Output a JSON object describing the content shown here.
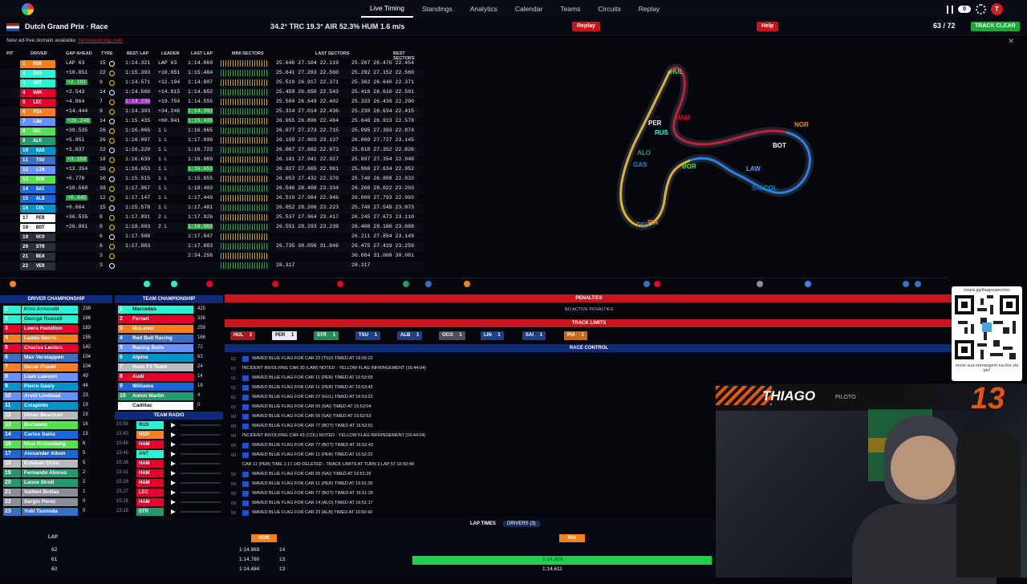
{
  "nav": {
    "items": [
      "Live Timing",
      "Standings",
      "Analytics",
      "Calendar",
      "Teams",
      "Circuits",
      "Replay"
    ],
    "active": "Live Timing",
    "counter": "0",
    "avatar": "T"
  },
  "header": {
    "title": "Dutch Grand Prix · Race",
    "weather": "34.2° TRC   19.3° AIR   52.3% HUM   1.6 m/s",
    "replay": "Replay",
    "help": "Help",
    "laps": "63 / 72",
    "status": "TRACK CLEAR"
  },
  "notice": {
    "text": "New ad-free domain available:",
    "link": "formula-timing.com"
  },
  "columns": [
    "PIT",
    "DRIVER",
    "GAP AHEAD",
    "TYRE",
    "BEST LAP",
    "LEADER",
    "LAST LAP",
    "MINI SECTORS",
    "LAST SECTORS",
    "BEST SECTORS"
  ],
  "timing": [
    {
      "p": "1",
      "d": "NOR",
      "c": "#f58020",
      "gap": "LAP 63",
      "ty": "15",
      "best": "1:14.321",
      "lead": "LAP 63",
      "last": "1:14.869",
      "ls": "25.646 27.104 22.119",
      "bs": "25.267 26.476 22.454"
    },
    {
      "p": "2",
      "d": "RUS",
      "c": "#27f4d2",
      "gap": "+10.851",
      "ty": "22",
      "best": "1:15.393",
      "lead": "+10.851",
      "last": "1:15.484",
      "ls": "25.641 27.283 22.560",
      "bs": "25.292 27.152 22.560"
    },
    {
      "p": "3",
      "d": "ANT",
      "c": "#27f4d2",
      "gap": "+2.101",
      "ty": "9",
      "best": "1:14.571",
      "lead": "+12.194",
      "last": "1:14.807",
      "ls": "25.519 26.917 22.371",
      "bs": "25.362 26.640 22.371"
    },
    {
      "p": "4",
      "d": "HAM",
      "c": "#e8002d",
      "gap": "+2.543",
      "ty": "14",
      "best": "1:14.566",
      "lead": "+14.815",
      "last": "1:14.652",
      "ls": "25.459 26.650 22.543",
      "bs": "25.410 26.610 22.501"
    },
    {
      "p": "5",
      "d": "LEC",
      "c": "#e8002d",
      "gap": "+4.864",
      "ty": "7",
      "best": "1:14.230",
      "lead": "+19.754",
      "last": "1:14.555",
      "ls": "25.504 26.649 22.402",
      "bs": "25.333 26.439 22.290"
    },
    {
      "p": "6",
      "d": "PIA",
      "c": "#f58020",
      "gap": "+14.444",
      "ty": "9",
      "best": "1:14.303",
      "lead": "+34.246",
      "last": "1:14.303",
      "ls": "25.314 27.014 22.436",
      "bs": "25.230 26.634 22.415"
    },
    {
      "p": "7",
      "d": "LAW",
      "c": "#6692ff",
      "gap": "+26.248",
      "ty": "14",
      "best": "1:15.435",
      "lead": "+60.841",
      "last": "1:15.435",
      "ls": "26.055 26.896 22.484",
      "bs": "25.648 26.913 22.578"
    },
    {
      "p": "8",
      "d": "HUL",
      "c": "#52e252",
      "gap": "+39.535",
      "ty": "26",
      "best": "1:16.065",
      "lead": "1 L",
      "last": "1:16.065",
      "ls": "26.077 27.273 22.715",
      "bs": "25.995 27.393 22.874"
    },
    {
      "p": "9",
      "d": "ALO",
      "c": "#229971",
      "gap": "+5.851",
      "ty": "26",
      "best": "1:16.097",
      "lead": "1 L",
      "last": "1:17.099",
      "ls": "26.159 27.803 23.137",
      "bs": "26.069 27.727 23.145"
    },
    {
      "p": "10",
      "d": "GAS",
      "c": "#0093cc",
      "gap": "+1.637",
      "ty": "22",
      "best": "1:16.220",
      "lead": "1 L",
      "last": "1:16.722",
      "ls": "26.067 27.682 22.973",
      "bs": "25.818 27.352 22.826"
    },
    {
      "p": "11",
      "d": "TSU",
      "c": "#3671c6",
      "gap": "+3.159",
      "ty": "18",
      "best": "1:16.639",
      "lead": "1 L",
      "last": "1:16.969",
      "ls": "26.101 27.941 22.927",
      "bs": "25.897 27.354 22.948"
    },
    {
      "p": "12",
      "d": "LIN",
      "c": "#6692ff",
      "gap": "+13.354",
      "ty": "16",
      "best": "1:16.653",
      "lead": "1 L",
      "last": "1:16.653",
      "ls": "26.027 27.665 22.961",
      "bs": "25.968 27.634 22.952"
    },
    {
      "p": "13",
      "d": "BOR",
      "c": "#52e252",
      "gap": "+0.778",
      "ty": "10",
      "best": "1:15.515",
      "lead": "1 L",
      "last": "1:15.855",
      "ls": "26.053 27.432 22.370",
      "bs": "25.740 26.808 22.833"
    },
    {
      "p": "14",
      "d": "SAI",
      "c": "#1868db",
      "gap": "+18.568",
      "ty": "38",
      "best": "1:17.967",
      "lead": "1 L",
      "last": "1:18.403",
      "ls": "26.546 28.408 23.334",
      "bs": "26.268 28.022 23.203"
    },
    {
      "p": "15",
      "d": "ALB",
      "c": "#1868db",
      "gap": "+0.445",
      "ty": "12",
      "best": "1:17.147",
      "lead": "1 L",
      "last": "1:17.449",
      "ls": "26.519 27.984 22.946",
      "bs": "26.000 27.793 22.993"
    },
    {
      "p": "16",
      "d": "COL",
      "c": "#0093cc",
      "gap": "+0.664",
      "ty": "15",
      "best": "1:15.578",
      "lead": "1 L",
      "last": "1:17.481",
      "ls": "26.052 28.206 23.223",
      "bs": "25.740 27.549 23.073"
    },
    {
      "p": "17",
      "d": "PER",
      "c": "#ffffff",
      "gap": "+36.535",
      "ty": "8",
      "best": "1:17.891",
      "lead": "2 L",
      "last": "1:17.926",
      "ls": "25.537 27.964 23.417",
      "bs": "26.245 27.673 23.110"
    },
    {
      "p": "18",
      "d": "BOT",
      "c": "#ffffff",
      "gap": "+26.801",
      "ty": "8",
      "best": "1:18.083",
      "lead": "2 L",
      "last": "1:18.083",
      "ls": "26.551 28.293 23.239",
      "bs": "26.408 28.180 23.088"
    },
    {
      "p": "19",
      "d": "OCO",
      "c": "#b6babd",
      "gap": "",
      "ty": "6",
      "best": "1:17.588",
      "lead": "",
      "last": "1:17.847",
      "ls": "",
      "bs": "26.211 27.854 23.149"
    },
    {
      "p": "20",
      "d": "STR",
      "c": "#229971",
      "gap": "",
      "ty": "6",
      "best": "1:17.883",
      "lead": "",
      "last": "1:17.883",
      "ls": "26.735 38.056 31.946",
      "bs": "26.475 27.419 23.259"
    },
    {
      "p": "21",
      "d": "BEA",
      "c": "#b6babd",
      "gap": "",
      "ty": "3",
      "best": "",
      "lead": "",
      "last": "2:34.256",
      "ls": "",
      "bs": "36.084 31.008 30.081"
    },
    {
      "p": "22",
      "d": "VER",
      "c": "#3671c6",
      "gap": "",
      "ty": "3",
      "best": "",
      "lead": "",
      "last": "",
      "ls": "28.317",
      "bs": "28.317"
    }
  ],
  "track_labels": [
    {
      "t": "NOR",
      "c": "#f58020"
    },
    {
      "t": "BOT",
      "c": "#ffffff"
    },
    {
      "t": "PER",
      "c": "#ffffff"
    },
    {
      "t": "HAM",
      "c": "#e8002d"
    },
    {
      "t": "HUL",
      "c": "#52e252"
    },
    {
      "t": "RUS",
      "c": "#27f4d2"
    },
    {
      "t": "ALO",
      "c": "#229971"
    },
    {
      "t": "GAS",
      "c": "#0093cc"
    },
    {
      "t": "BOR",
      "c": "#52e252"
    },
    {
      "t": "LAW",
      "c": "#6692ff"
    },
    {
      "t": "SAI",
      "c": "#1868db"
    },
    {
      "t": "COL",
      "c": "#0093cc"
    },
    {
      "t": "PIA",
      "c": "#f58020"
    },
    {
      "t": "TSU",
      "c": "#3671c6"
    }
  ],
  "driver_championship": {
    "title": "DRIVER CHAMPIONSHIP",
    "rows": [
      {
        "p": "1",
        "n": "Kimi Antonelli",
        "c": "#27f4d2",
        "pts": "239"
      },
      {
        "p": "2",
        "n": "George Russell",
        "c": "#27f4d2",
        "pts": "186"
      },
      {
        "p": "3",
        "n": "Lewis Hamilton",
        "c": "#e8002d",
        "pts": "183"
      },
      {
        "p": "4",
        "n": "Lando Norris",
        "c": "#f58020",
        "pts": "155"
      },
      {
        "p": "5",
        "n": "Charles Leclerc",
        "c": "#e8002d",
        "pts": "142"
      },
      {
        "p": "6",
        "n": "Max Verstappen",
        "c": "#3671c6",
        "pts": "104"
      },
      {
        "p": "7",
        "n": "Oscar Piastri",
        "c": "#f58020",
        "pts": "104"
      },
      {
        "p": "8",
        "n": "Liam Lawson",
        "c": "#6692ff",
        "pts": "49"
      },
      {
        "p": "9",
        "n": "Pierre Gasly",
        "c": "#0093cc",
        "pts": "44"
      },
      {
        "p": "10",
        "n": "Arvid Lindblad",
        "c": "#6692ff",
        "pts": "23"
      },
      {
        "p": "11",
        "n": "Colapinto",
        "c": "#0093cc",
        "pts": "19"
      },
      {
        "p": "12",
        "n": "Oliver Bearman",
        "c": "#b6babd",
        "pts": "19"
      },
      {
        "p": "13",
        "n": "Bortoleto",
        "c": "#52e252",
        "pts": "16"
      },
      {
        "p": "14",
        "n": "Carlos Sainz",
        "c": "#1868db",
        "pts": "13"
      },
      {
        "p": "16",
        "n": "Nico Hulkenberg",
        "c": "#52e252",
        "pts": "6"
      },
      {
        "p": "17",
        "n": "Alexander Albon",
        "c": "#1868db",
        "pts": "5"
      },
      {
        "p": "18",
        "n": "Esteban Ocon",
        "c": "#b6babd",
        "pts": "5"
      },
      {
        "p": "19",
        "n": "Fernando Alonso",
        "c": "#229971",
        "pts": "2"
      },
      {
        "p": "20",
        "n": "Lance Stroll",
        "c": "#229971",
        "pts": "2"
      },
      {
        "p": "21",
        "n": "Valtteri Bottas",
        "c": "#8a8f99",
        "pts": "1"
      },
      {
        "p": "22",
        "n": "Sergio Perez",
        "c": "#8a8f99",
        "pts": "0"
      },
      {
        "p": "23",
        "n": "Yuki Tsunoda",
        "c": "#3671c6",
        "pts": "0"
      }
    ]
  },
  "team_championship": {
    "title": "TEAM CHAMPIONSHIP",
    "rows": [
      {
        "p": "1",
        "n": "Mercedes",
        "c": "#27f4d2",
        "pts": "425"
      },
      {
        "p": "2",
        "n": "Ferrari",
        "c": "#e8002d",
        "pts": "338"
      },
      {
        "p": "3",
        "n": "McLaren",
        "c": "#f58020",
        "pts": "259"
      },
      {
        "p": "4",
        "n": "Red Bull Racing",
        "c": "#3671c6",
        "pts": "166"
      },
      {
        "p": "5",
        "n": "Racing Bulls",
        "c": "#6692ff",
        "pts": "72"
      },
      {
        "p": "6",
        "n": "Alpine",
        "c": "#0093cc",
        "pts": "63"
      },
      {
        "p": "7",
        "n": "Haas F1 Team",
        "c": "#b6babd",
        "pts": "24"
      },
      {
        "p": "8",
        "n": "Audi",
        "c": "#e8002d",
        "pts": "14"
      },
      {
        "p": "9",
        "n": "Williams",
        "c": "#1868db",
        "pts": "18"
      },
      {
        "p": "10",
        "n": "Aston Martin",
        "c": "#229971",
        "pts": "4"
      },
      {
        "p": "11",
        "n": "Cadillac",
        "c": "#ffffff",
        "pts": "0"
      }
    ]
  },
  "team_radio": {
    "title": "TEAM RADIO",
    "rows": [
      {
        "t": "15:58",
        "d": "RUS",
        "c": "#27f4d2"
      },
      {
        "t": "15:40",
        "d": "NOR",
        "c": "#f58020"
      },
      {
        "t": "15:48",
        "d": "HAM",
        "c": "#e8002d"
      },
      {
        "t": "15:46",
        "d": "ANT",
        "c": "#27f4d2"
      },
      {
        "t": "15:38",
        "d": "HAM",
        "c": "#e8002d"
      },
      {
        "t": "15:31",
        "d": "HAM",
        "c": "#e8002d"
      },
      {
        "t": "15:28",
        "d": "HAM",
        "c": "#e8002d"
      },
      {
        "t": "15:27",
        "d": "LEC",
        "c": "#e8002d"
      },
      {
        "t": "15:18",
        "d": "HAM",
        "c": "#e8002d"
      },
      {
        "t": "15:18",
        "d": "STR",
        "c": "#229971"
      }
    ]
  },
  "penalties": {
    "title": "PENALTIES",
    "empty": "NO ACTIVE PENALTIES"
  },
  "track_limits": {
    "title": "TRACK LIMITS",
    "chips": [
      {
        "d": "HUL",
        "n": "2",
        "c": "#b0141c"
      },
      {
        "d": "PER",
        "n": "1",
        "c": "#e9ecf2"
      },
      {
        "d": "STR",
        "n": "1",
        "c": "#1f8f55"
      },
      {
        "d": "TSU",
        "n": "1",
        "c": "#1e3f8a"
      },
      {
        "d": "ALB",
        "n": "1",
        "c": "#1e3f8a"
      },
      {
        "d": "OCO",
        "n": "1",
        "c": "#4a4f58"
      },
      {
        "d": "LIN",
        "n": "1",
        "c": "#1e3f8a"
      },
      {
        "d": "SAI",
        "n": "1",
        "c": "#1e3f8a"
      },
      {
        "d": "PIA",
        "n": "1",
        "c": "#c96a10"
      }
    ]
  },
  "race_control": {
    "title": "RACE CONTROL",
    "rows": [
      {
        "n": "62",
        "t": "WAVED BLUE FLAG FOR CAR 22 (TSU) TIMED AT 16:55:22",
        "f": true
      },
      {
        "n": "61",
        "t": "INCIDENT INVOLVING CAR 30 (LAW) NOTED - YELLOW FLAG INFRINGEMENT (16:44:04)",
        "f": false
      },
      {
        "n": "61",
        "t": "WAVED BLUE FLAG FOR CAR 11 (PER) TIMED AT 16:53:58",
        "f": true
      },
      {
        "n": "61",
        "t": "WAVED BLUE FLAG FOR CAR 11 (PER) TIMED AT 16:53:43",
        "f": true
      },
      {
        "n": "61",
        "t": "WAVED BLUE FLAG FOR CAR 27 (HUL) TIMED AT 16:53:22",
        "f": true
      },
      {
        "n": "61",
        "t": "WAVED BLUE FLAG FOR CAR 55 (SAI) TIMED AT 16:53:04",
        "f": true
      },
      {
        "n": "60",
        "t": "WAVED BLUE FLAG FOR CAR 55 (SAI) TIMED AT 16:52:53",
        "f": true
      },
      {
        "n": "60",
        "t": "WAVED BLUE FLAG FOR CAR 77 (BOT) TIMED AT 16:52:51",
        "f": true
      },
      {
        "n": "60",
        "t": "INCIDENT INVOLVING CAR 43 (COL) NOTED - YELLOW FLAG INFRINGEMENT (16:44:04)",
        "f": false
      },
      {
        "n": "60",
        "t": "WAVED BLUE FLAG FOR CAR 77 (BOT) TIMED AT 16:52:43",
        "f": true
      },
      {
        "n": "60",
        "t": "WAVED BLUE FLAG FOR CAR 11 (PER) TIMED AT 16:52:22",
        "f": true
      },
      {
        "n": "",
        "t": "CAR 11 (PER) TIME 1:17.149 DELETED - TRACK LIMITS AT TURN 3 LAP 57 16:50:48",
        "f": false
      },
      {
        "n": "59",
        "t": "WAVED BLUE FLAG FOR CAR 55 (SAI) TIMED AT 16:51:35",
        "f": true
      },
      {
        "n": "59",
        "t": "WAVED BLUE FLAG FOR CAR 11 (PER) TIMED AT 16:51:30",
        "f": true
      },
      {
        "n": "59",
        "t": "WAVED BLUE FLAG FOR CAR 77 (BOT) TIMED AT 16:51:28",
        "f": true
      },
      {
        "n": "59",
        "t": "WAVED BLUE FLAG FOR CAR 14 (ALO) TIMED AT 16:51:17",
        "f": true
      },
      {
        "n": "59",
        "t": "WAVED BLUE FLAG FOR CAR 23 (ALB) TIMED AT 16:50:43",
        "f": true
      },
      {
        "n": "58",
        "t": "WAVED BLUE FLAG FOR CAR 23 (ALB) TIMED AT 16:50:36",
        "f": true
      }
    ]
  },
  "lap_times": {
    "title": "LAP TIMES",
    "filter": "DRIVERS (3)",
    "lap_header": "LAP",
    "d1": "NOR",
    "d2": "PIA",
    "rows": [
      {
        "lap": "62",
        "a": "1:14.869",
        "an": "14",
        "b": ""
      },
      {
        "lap": "61",
        "a": "1:14.760",
        "an": "13",
        "b": "1:14.303"
      },
      {
        "lap": "60",
        "a": "1:14.484",
        "an": "13",
        "b": "1:14.611"
      }
    ]
  },
  "qr": {
    "top": "livepix.gg/thiagosannches",
    "bottom": "envie sua mensagem na live via pix!"
  },
  "overlay": {
    "name": "THIAGO",
    "role": "PILOTO",
    "number": "13"
  }
}
